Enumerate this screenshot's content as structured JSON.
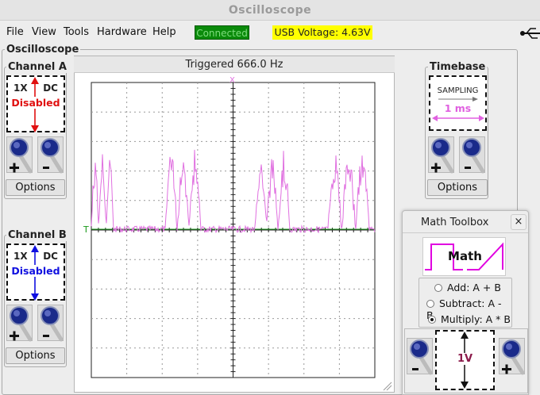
{
  "window": {
    "title": "Oscilloscope"
  },
  "menu": {
    "items": [
      "File",
      "View",
      "Tools",
      "Hardware",
      "Help"
    ]
  },
  "status": {
    "connection": "Connected",
    "usb_voltage": "USB Voltage: 4.63V"
  },
  "scope": {
    "group_title": "Oscilloscope",
    "trigger_text": "Triggered 666.0 Hz",
    "cursor_x_label": "X",
    "trigger_marker": "T"
  },
  "channel_a": {
    "title": "Channel A",
    "gain": "1X",
    "coupling": "DC",
    "state": "Disabled",
    "color": "#e01010",
    "options_label": "Options"
  },
  "channel_b": {
    "title": "Channel B",
    "gain": "1X",
    "coupling": "DC",
    "state": "Disabled",
    "color": "#1010e0",
    "options_label": "Options"
  },
  "timebase": {
    "title": "Timebase",
    "mode": "SAMPLING",
    "value": "1 ms",
    "color": "#e060e0",
    "options_label": "Options"
  },
  "math_toolbox": {
    "title": "Math Toolbox",
    "logo_text": "Math",
    "close_glyph": "×",
    "options": [
      "Add: A + B",
      "Subtract: A - B",
      "Multiply: A * B"
    ],
    "selected": "Multiply: A * B",
    "scale": "1V",
    "scale_color": "#8b1a4a"
  },
  "trace": {
    "color": "#e070e0",
    "trigger_line_color": "#1a9a1a"
  }
}
